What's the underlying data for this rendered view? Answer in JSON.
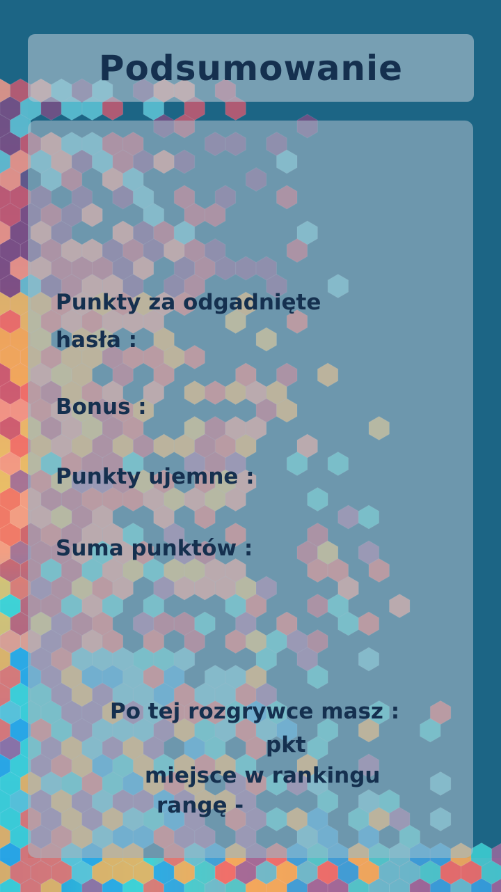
{
  "title": "Podsumowanie",
  "stats": {
    "guessed_label": "Punkty za odgadnięte\nhasła :",
    "guessed_value": "",
    "bonus_label": "Bonus :",
    "bonus_value": "",
    "negative_label": "Punkty ujemne :",
    "negative_value": "",
    "sum_label": "Suma punktów :",
    "sum_value": ""
  },
  "summary": {
    "intro": "Po tej rozgrywce masz :",
    "points_value": "",
    "points_unit": "pkt",
    "rank_value": "",
    "rank_label": "miejsce w rankingu",
    "range_label": "rangę -",
    "range_value": ""
  },
  "colors": {
    "background": "#1c6585",
    "text": "#15304f",
    "panel": "#a8bcc9"
  }
}
